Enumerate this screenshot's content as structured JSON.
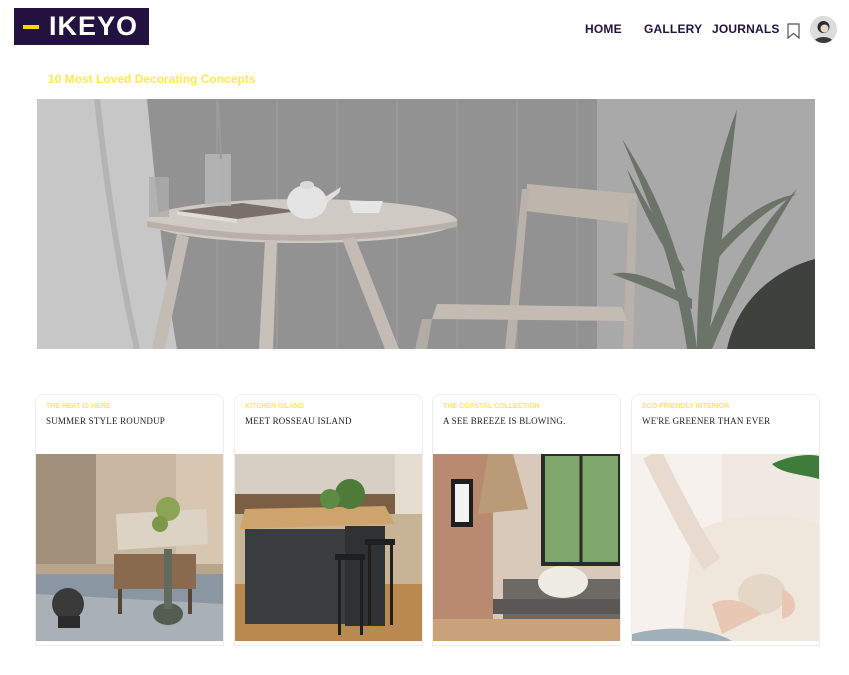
{
  "header": {
    "logo_text": "IKEYO",
    "nav": [
      "HOME",
      "GALLERY",
      "JOURNALS"
    ],
    "bookmark_icon": "bookmark-icon",
    "avatar": "user-avatar"
  },
  "hero": {
    "title": "10 Most Loved Decorating Concepts"
  },
  "cards": [
    {
      "kicker": "THE HEAT IS HERE",
      "title": "SUMMER STYLE ROUNDUP"
    },
    {
      "kicker": "KITCHEN ISLAND",
      "title": "MEET ROSSEAU ISLAND"
    },
    {
      "kicker": "THE COASTAL COLLECTION",
      "title": "A SEE BREEZE IS BLOWING."
    },
    {
      "kicker": "ECO-FRIENDLY INTERIOR",
      "title": "WE'RE GREENER THAN EVER"
    }
  ],
  "colors": {
    "brand": "#23123f",
    "accent": "#f5d800",
    "kicker": "#ffe94f"
  }
}
